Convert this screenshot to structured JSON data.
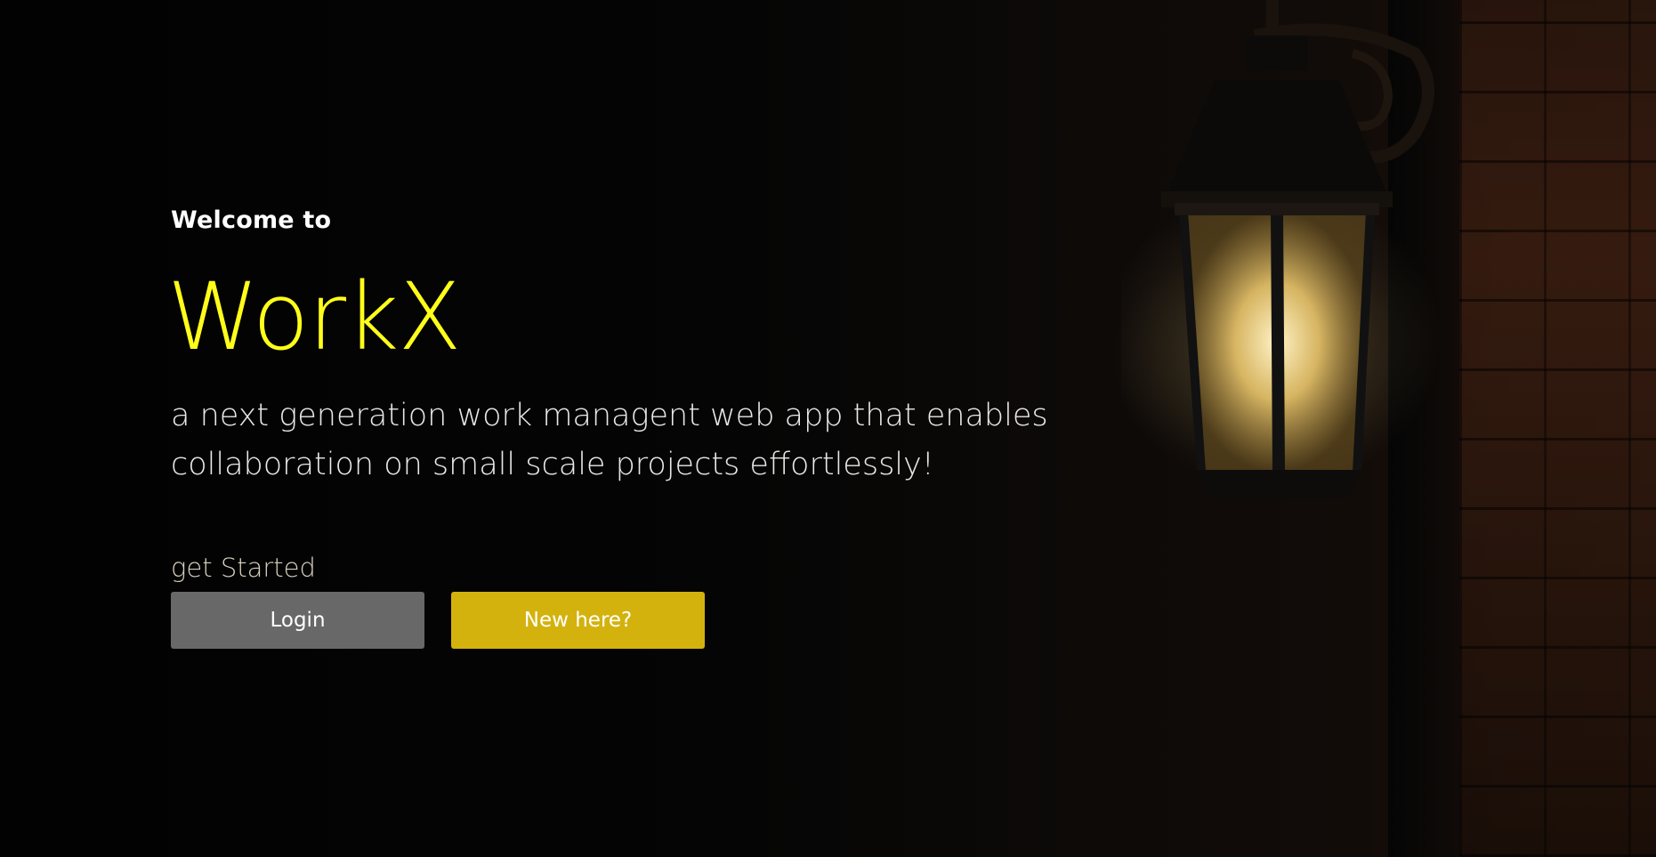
{
  "hero": {
    "welcome_text": "Welcome to",
    "brand_name": "WorkX",
    "tagline": "a next generation work managent web app that enables collaboration on small scale projects effortlessly!",
    "get_started_label": "get Started"
  },
  "actions": {
    "login_label": "Login",
    "signup_label": "New here?"
  },
  "colors": {
    "brand": "#ffff1a",
    "login_button": "#686868",
    "signup_button": "#d4b20e",
    "background": "#000000"
  },
  "background_image": {
    "subject": "lantern-icon"
  }
}
